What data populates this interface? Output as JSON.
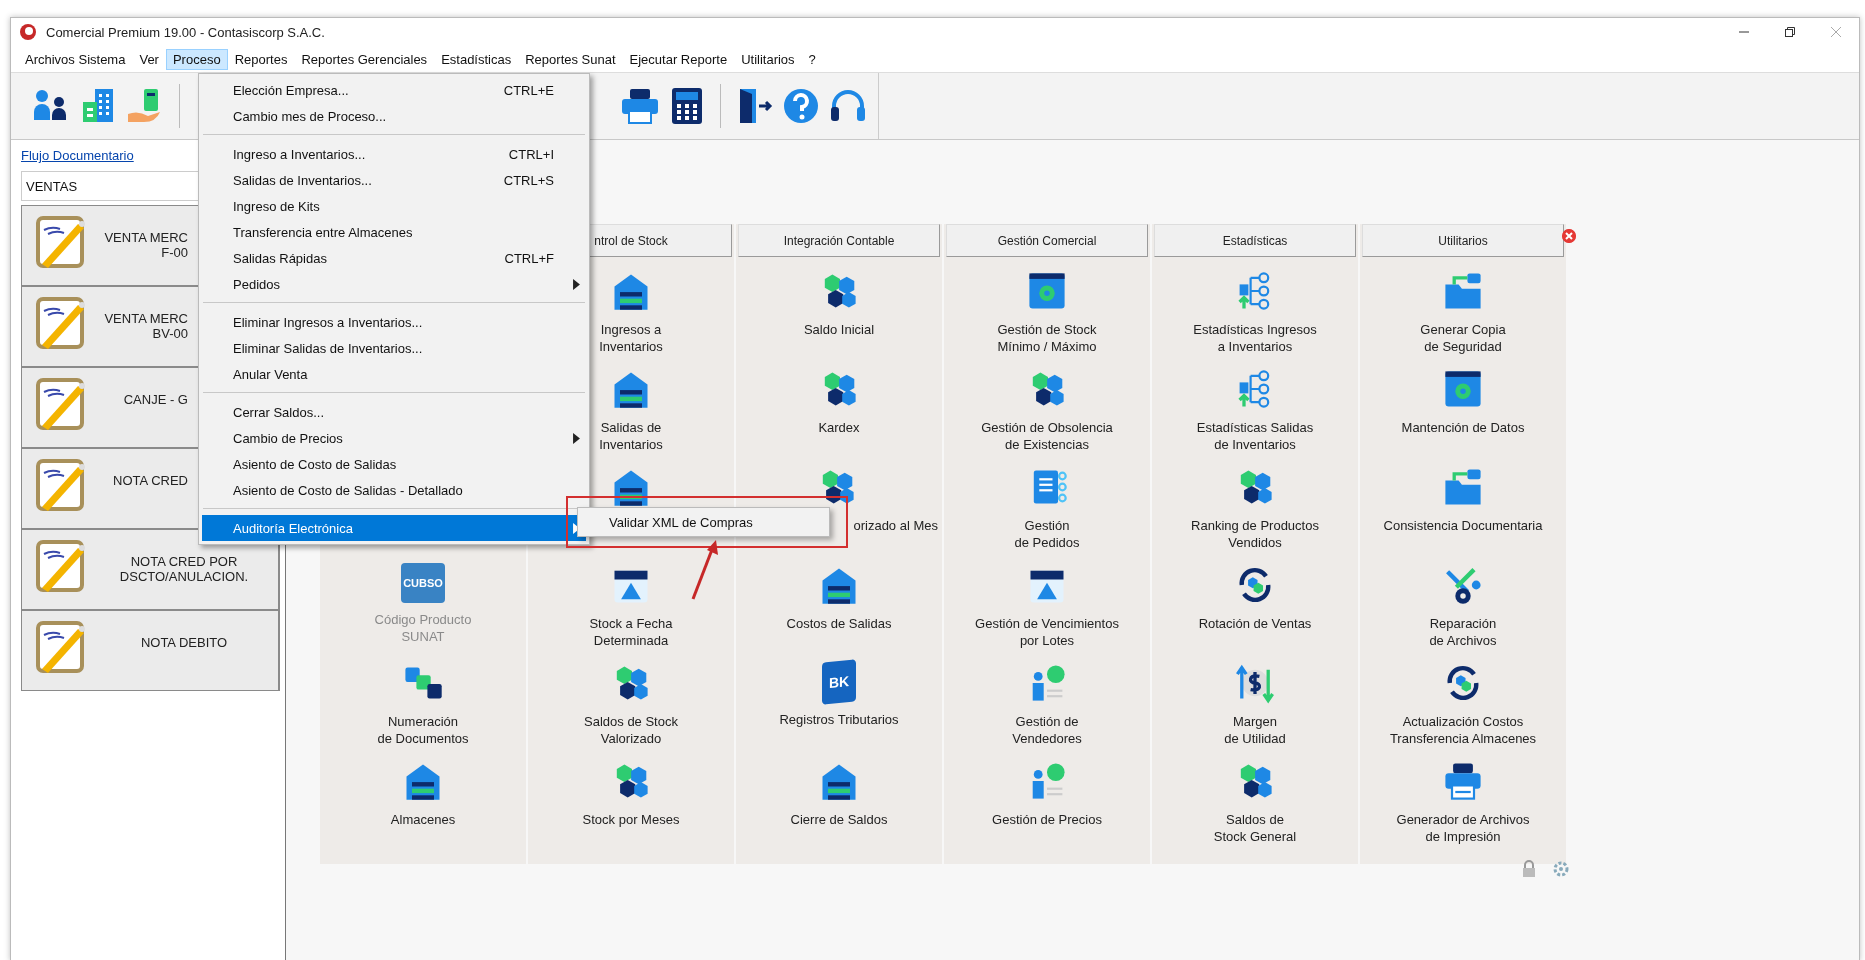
{
  "window": {
    "title": "Comercial Premium 19.00 - Contasiscorp S.A.C."
  },
  "menu_bar": [
    {
      "label": "Archivos Sistema",
      "selected": false
    },
    {
      "label": "Ver",
      "selected": false
    },
    {
      "label": "Proceso",
      "selected": true
    },
    {
      "label": "Reportes",
      "selected": false
    },
    {
      "label": "Reportes Gerenciales",
      "selected": false
    },
    {
      "label": "Estadísticas",
      "selected": false
    },
    {
      "label": "Reportes Sunat",
      "selected": false
    },
    {
      "label": "Ejecutar Reporte",
      "selected": false
    },
    {
      "label": "Utilitarios",
      "selected": false
    },
    {
      "label": "?",
      "selected": false
    }
  ],
  "process_menu": [
    {
      "kind": "item",
      "label": "Elección Empresa...",
      "shortcut": "CTRL+E",
      "has_submenu": false,
      "selected": false
    },
    {
      "kind": "item",
      "label": "Cambio mes de Proceso...",
      "has_submenu": false,
      "selected": false
    },
    {
      "kind": "separator"
    },
    {
      "kind": "item",
      "label": "Ingreso a Inventarios...",
      "shortcut": "CTRL+I",
      "has_submenu": false,
      "selected": false
    },
    {
      "kind": "item",
      "label": "Salidas de Inventarios...",
      "shortcut": "CTRL+S",
      "has_submenu": false,
      "selected": false
    },
    {
      "kind": "item",
      "label": "Ingreso de Kits",
      "has_submenu": false,
      "selected": false
    },
    {
      "kind": "item",
      "label": "Transferencia entre Almacenes",
      "has_submenu": false,
      "selected": false
    },
    {
      "kind": "item",
      "label": "Salidas Rápidas",
      "shortcut": "CTRL+F",
      "has_submenu": false,
      "selected": false
    },
    {
      "kind": "item",
      "label": "Pedidos",
      "has_submenu": true,
      "selected": false
    },
    {
      "kind": "separator"
    },
    {
      "kind": "item",
      "label": "Eliminar Ingresos a Inventarios...",
      "has_submenu": false,
      "selected": false
    },
    {
      "kind": "item",
      "label": "Eliminar Salidas de Inventarios...",
      "has_submenu": false,
      "selected": false
    },
    {
      "kind": "item",
      "label": "Anular Venta",
      "has_submenu": false,
      "selected": false
    },
    {
      "kind": "separator"
    },
    {
      "kind": "item",
      "label": "Cerrar Saldos...",
      "has_submenu": false,
      "selected": false
    },
    {
      "kind": "item",
      "label": "Cambio de Precios",
      "has_submenu": true,
      "selected": false
    },
    {
      "kind": "item",
      "label": "Asiento de Costo de Salidas",
      "has_submenu": false,
      "selected": false
    },
    {
      "kind": "item",
      "label": "Asiento de Costo de Salidas - Detallado",
      "has_submenu": false,
      "selected": false
    },
    {
      "kind": "separator"
    },
    {
      "kind": "item",
      "label": "Auditoría Electrónica",
      "has_submenu": true,
      "selected": true
    }
  ],
  "submenu": [
    {
      "label": "Validar XML de Compras"
    }
  ],
  "sidebar": {
    "link": "Flujo Documentario",
    "section": "VENTAS",
    "documents": [
      {
        "label": "VENTA MERC\nF-00"
      },
      {
        "label": "VENTA MERC\nBV-00"
      },
      {
        "label": "CANJE - G"
      },
      {
        "label": "NOTA CRED"
      },
      {
        "label": "NOTA CRED POR\nDSCTO/ANULACION."
      },
      {
        "label": "NOTA DEBITO"
      }
    ]
  },
  "modules": [
    {
      "items": [
        {
          "label": "Código Producto\nSUNAT",
          "icon_text": "CUBSO",
          "disabled": true
        },
        {
          "label": "Numeración\nde Documentos",
          "disabled": false
        },
        {
          "label": "Almacenes",
          "disabled": false
        }
      ]
    },
    {
      "header": "ntrol de Stock",
      "items": [
        {
          "label": "Ingresos a\nInventarios",
          "disabled": false
        },
        {
          "label": "Salidas de\nInventarios",
          "disabled": false
        },
        {
          "disabled": false
        },
        {
          "label": "Stock a Fecha\nDeterminada",
          "disabled": false
        },
        {
          "label": "Saldos de Stock\nValorizado",
          "disabled": false
        },
        {
          "label": "Stock por Meses",
          "disabled": false
        }
      ]
    },
    {
      "header": "Integración Contable",
      "items": [
        {
          "label": "Saldo Inicial",
          "disabled": false
        },
        {
          "label": "Kardex",
          "disabled": false
        },
        {
          "label": "orizado al Mes",
          "disabled": false
        },
        {
          "label": "Costos de Salidas",
          "disabled": false
        },
        {
          "label": "Registros Tributarios",
          "icon_text": "BK",
          "disabled": false
        },
        {
          "label": "Cierre de Saldos",
          "disabled": false
        }
      ]
    },
    {
      "header": "Gestión Comercial",
      "items": [
        {
          "label": "Gestión de Stock\nMínimo / Máximo",
          "disabled": false
        },
        {
          "label": "Gestión de Obsolencia\nde Existencias",
          "disabled": false
        },
        {
          "label": "Gestión\nde Pedidos",
          "disabled": false
        },
        {
          "label": "Gestión de Vencimientos\npor Lotes",
          "disabled": false
        },
        {
          "label": "Gestión de\nVendedores",
          "disabled": false
        },
        {
          "label": "Gestión de Precios",
          "disabled": false
        }
      ]
    },
    {
      "header": "Estadísticas",
      "items": [
        {
          "label": "Estadísticas Ingresos\na Inventarios",
          "disabled": false
        },
        {
          "label": "Estadísticas Salidas\nde Inventarios",
          "disabled": false
        },
        {
          "label": "Ranking de Productos\nVendidos",
          "disabled": false
        },
        {
          "label": "Rotación de Ventas",
          "disabled": false
        },
        {
          "label": "Margen\nde Utilidad",
          "disabled": false
        },
        {
          "label": "Saldos de\nStock General",
          "disabled": false
        }
      ]
    },
    {
      "header": "Utilitarios",
      "items": [
        {
          "label": "Generar Copia\nde Seguridad",
          "disabled": false
        },
        {
          "label": "Mantención de Datos",
          "disabled": false
        },
        {
          "label": "Consistencia Documentaria",
          "disabled": false
        },
        {
          "label": "Reparación\nde Archivos",
          "disabled": false
        },
        {
          "label": "Actualización Costos\nTransferencia Almacenes",
          "disabled": false
        },
        {
          "label": "Generador de Archivos\nde Impresión",
          "disabled": false
        }
      ]
    }
  ]
}
